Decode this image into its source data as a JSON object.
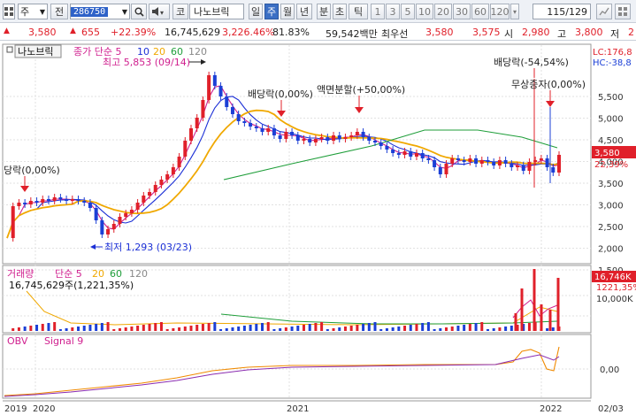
{
  "toolbar": {
    "type_select": "주",
    "prev_button": "전",
    "code_value": "286750",
    "search_button": "Q",
    "market_button": "코",
    "stock_name": "나노브릭",
    "period_tabs": [
      "일",
      "주",
      "월",
      "년",
      "분",
      "초",
      "틱"
    ],
    "active_period": "주",
    "interval_buttons": [
      "1",
      "3",
      "5",
      "10",
      "20",
      "30",
      "60",
      "120"
    ],
    "count_display": "115/129"
  },
  "quote": {
    "price": "3,580",
    "change": "655",
    "change_pct": "+22.39%",
    "volume": "16,745,629",
    "volume_pct": "3,226.46%",
    "ratio": "81.83%",
    "amount": "59,542백만",
    "best_label": "최우선",
    "best_ask": "3,580",
    "best_bid": "3,575",
    "open_label": "시",
    "open": "2,980",
    "high_label": "고",
    "high": "3,800",
    "low_label": "저",
    "low": "2"
  },
  "price_panel": {
    "title": "나노브릭",
    "legend": [
      {
        "label": "종가 단순 5",
        "color": "#d0208f"
      },
      {
        "label": "10",
        "color": "#1b2fd6"
      },
      {
        "label": "20",
        "color": "#f0a800"
      },
      {
        "label": "60",
        "color": "#1f9e3a"
      },
      {
        "label": "120",
        "color": "#888888"
      }
    ],
    "high_annotation": "최고 5,853 (09/14)",
    "low_annotation": "최저 1,293 (03/23)",
    "events": [
      {
        "label": "당락(0,00%)"
      },
      {
        "label": "배당락(0,00%)"
      },
      {
        "label": "액면분할(+50,00%)"
      },
      {
        "label": "배당락(-54,54%)"
      },
      {
        "label": "무상증자(0,00%)"
      }
    ],
    "lc": "LC:176,8",
    "hc": "HC:-38,8",
    "current_price_tag": "3,580",
    "current_pct_tag": "22,39%",
    "y_axis": [
      "5,500",
      "5,000",
      "4,500",
      "4,000",
      "3,500",
      "3,000",
      "2,500",
      "2,000",
      "1,500"
    ]
  },
  "volume_panel": {
    "legend": [
      {
        "label": "거래량",
        "color": "#d0208f"
      },
      {
        "label": "단순 5",
        "color": "#d0208f"
      },
      {
        "label": "20",
        "color": "#f0a800"
      },
      {
        "label": "60",
        "color": "#1f9e3a"
      },
      {
        "label": "120",
        "color": "#888888"
      }
    ],
    "value_label": "16,745,629주(1,221,35%)",
    "tag_value": "16,746K",
    "tag_pct": "1221,35%",
    "y_axis": [
      "10,000K"
    ]
  },
  "obv_panel": {
    "legend": [
      {
        "label": "OBV",
        "color": "#d0208f"
      },
      {
        "label": "Signal 9",
        "color": "#d0208f"
      }
    ],
    "y_axis": [
      "0,00"
    ]
  },
  "x_axis": [
    "2019",
    "2020",
    "2021",
    "2022",
    "02/03"
  ]
}
